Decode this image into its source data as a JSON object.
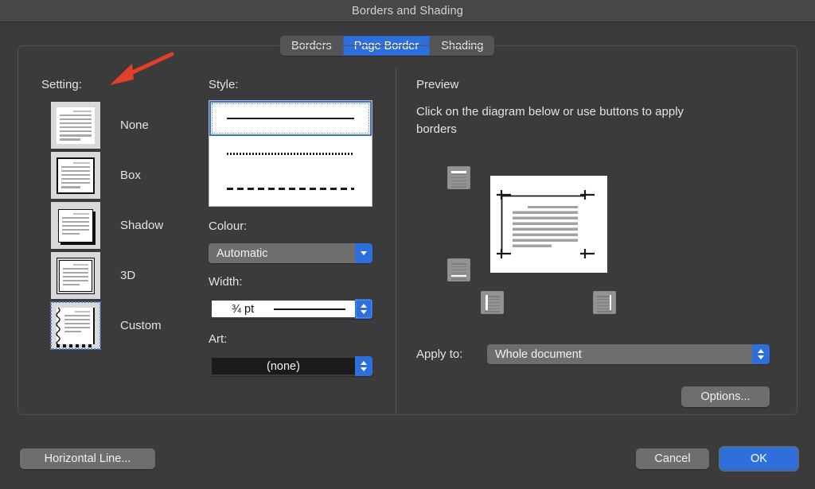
{
  "window": {
    "title": "Borders and Shading"
  },
  "tabs": [
    {
      "label": "Borders",
      "selected": false
    },
    {
      "label": "Page Border",
      "selected": true
    },
    {
      "label": "Shading",
      "selected": false
    }
  ],
  "setting": {
    "heading": "Setting:",
    "options": [
      {
        "label": "None",
        "style": "none",
        "selected": false
      },
      {
        "label": "Box",
        "style": "box",
        "selected": false
      },
      {
        "label": "Shadow",
        "style": "shadow",
        "selected": false
      },
      {
        "label": "3D",
        "style": "3d",
        "selected": false
      },
      {
        "label": "Custom",
        "style": "custom",
        "selected": true
      }
    ]
  },
  "style": {
    "heading": "Style:",
    "items": [
      {
        "kind": "solid",
        "selected": true
      },
      {
        "kind": "dotted",
        "selected": false
      },
      {
        "kind": "dashed",
        "selected": false
      }
    ]
  },
  "colour": {
    "heading": "Colour:",
    "value": "Automatic",
    "icon": "chevron-down-icon"
  },
  "width": {
    "heading": "Width:",
    "value": "¾ pt",
    "icon": "stepper-icon"
  },
  "art": {
    "heading": "Art:",
    "value": "(none)",
    "icon": "stepper-icon"
  },
  "preview": {
    "heading": "Preview",
    "help_text": "Click on the diagram below or use buttons to apply borders",
    "border_buttons": [
      {
        "name": "top-border-button",
        "edge": "top"
      },
      {
        "name": "bottom-border-button",
        "edge": "bottom"
      },
      {
        "name": "left-border-button",
        "edge": "left"
      },
      {
        "name": "right-border-button",
        "edge": "right"
      }
    ]
  },
  "apply_to": {
    "label": "Apply to:",
    "value": "Whole document",
    "icon": "stepper-icon"
  },
  "buttons": {
    "options": "Options...",
    "horizontal_line": "Horizontal Line...",
    "cancel": "Cancel",
    "ok": "OK"
  },
  "colors": {
    "accent_blue": "#2f6fdc",
    "dialog_bg": "#3b3b3b",
    "titlebar_bg": "#474747",
    "control_gray": "#6e6e6e",
    "annotation_red": "#e0412a"
  },
  "annotation": {
    "type": "arrow",
    "points_to": "Setting:"
  }
}
